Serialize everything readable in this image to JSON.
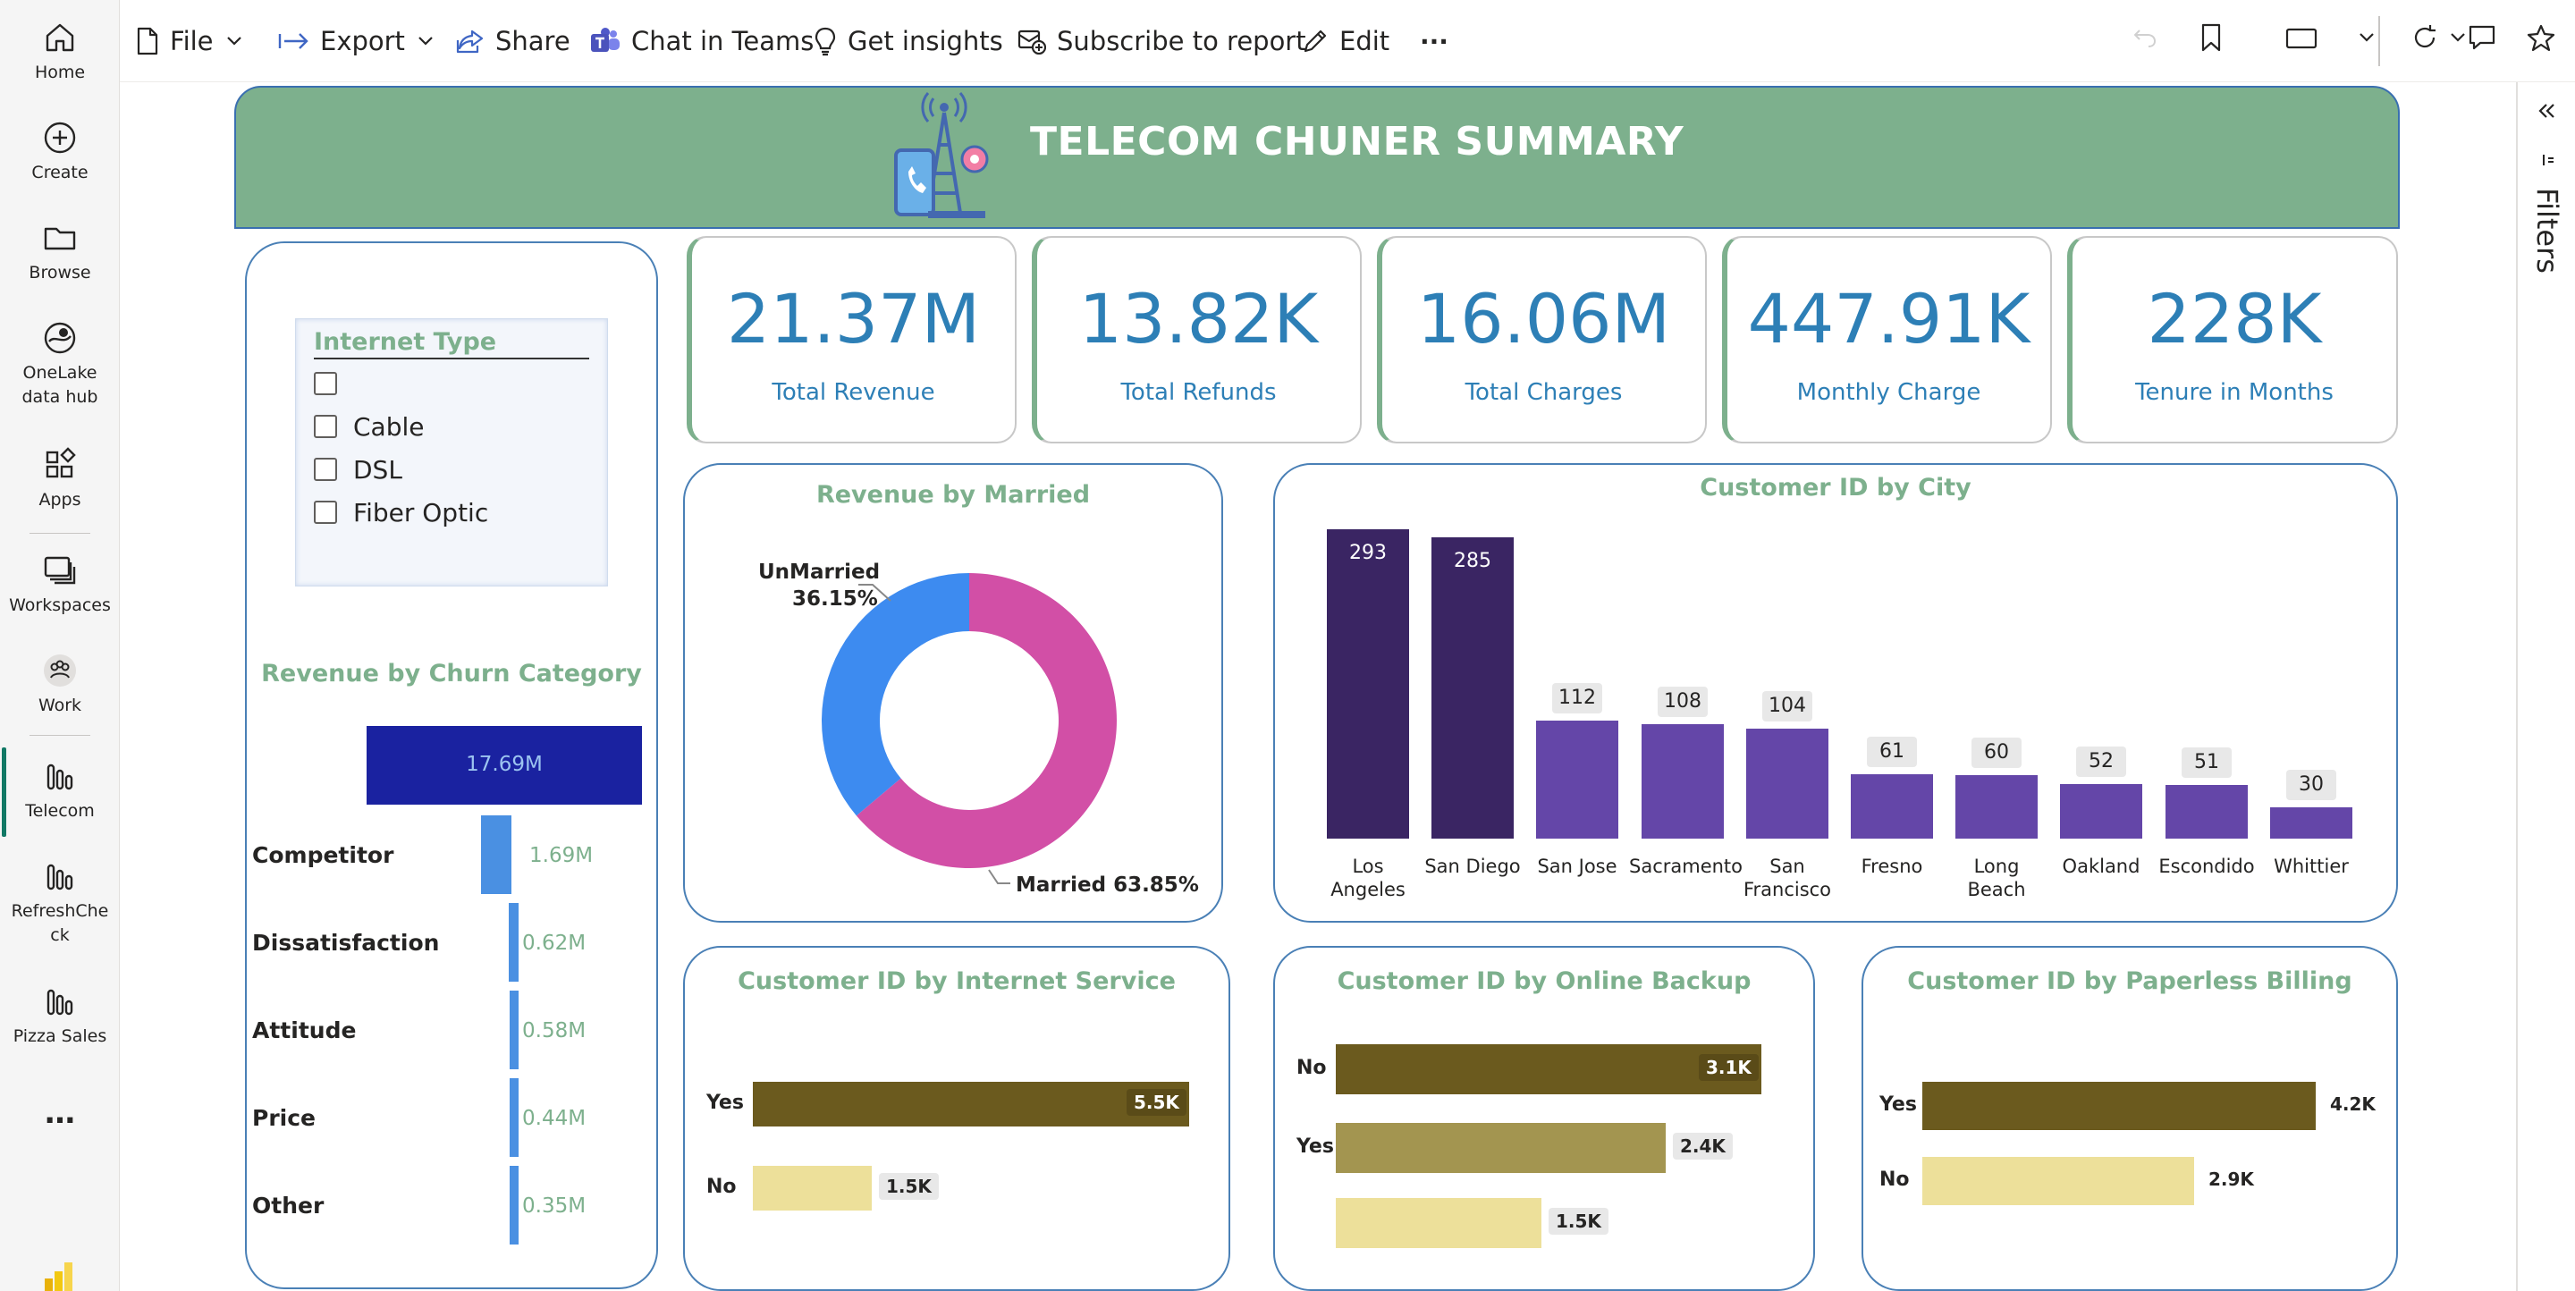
{
  "nav": {
    "items": [
      {
        "label": "Home",
        "icon": "home-icon"
      },
      {
        "label": "Create",
        "icon": "plus-circle-icon"
      },
      {
        "label": "Browse",
        "icon": "folder-icon"
      },
      {
        "label": "OneLake data hub",
        "icon": "onelake-icon"
      },
      {
        "label": "Apps",
        "icon": "apps-icon"
      },
      {
        "label": "Workspaces",
        "icon": "workspaces-icon"
      },
      {
        "label": "Work",
        "icon": "work-icon"
      },
      {
        "label": "Telecom",
        "icon": "report-icon"
      },
      {
        "label": "RefreshCheck",
        "icon": "report-icon"
      },
      {
        "label": "Pizza Sales",
        "icon": "report-icon"
      }
    ],
    "more": "…",
    "active": "Telecom"
  },
  "toolbar": {
    "file": "File",
    "export": "Export",
    "share": "Share",
    "chat": "Chat in Teams",
    "insights": "Get insights",
    "subscribe": "Subscribe to report",
    "edit": "Edit",
    "more": "···"
  },
  "filters": {
    "label": "Filters"
  },
  "report": {
    "title": "TELECOM CHUNER SUMMARY",
    "accent": "#7db08d",
    "kpi_color": "#2d7fb6",
    "kpis": [
      {
        "value": "21.37M",
        "label": "Total Revenue"
      },
      {
        "value": "13.82K",
        "label": "Total Refunds"
      },
      {
        "value": "16.06M",
        "label": "Total Charges"
      },
      {
        "value": "447.91K",
        "label": "Monthly Charge"
      },
      {
        "value": "228K",
        "label": "Tenure in Months"
      }
    ],
    "slicer": {
      "title": "Internet Type",
      "options": [
        "",
        "Cable",
        "DSL",
        "Fiber Optic"
      ]
    }
  },
  "chart_data": [
    {
      "type": "bar",
      "orientation": "horizontal",
      "title": "Revenue by Churn Category",
      "categories": [
        "",
        "Competitor",
        "Dissatisfaction",
        "Attitude",
        "Price",
        "Other"
      ],
      "values": [
        17.69,
        1.69,
        0.62,
        0.58,
        0.44,
        0.35
      ],
      "value_labels": [
        "17.69M",
        "1.69M",
        "0.62M",
        "0.58M",
        "0.44M",
        "0.35M"
      ],
      "unit": "M"
    },
    {
      "type": "pie",
      "donut": true,
      "title": "Revenue by Married",
      "labels": [
        "UnMarried",
        "Married"
      ],
      "values": [
        36.15,
        63.85
      ],
      "value_labels": [
        "36.15%",
        "63.85%"
      ],
      "colors": [
        "#3d8bf0",
        "#d24fa6"
      ]
    },
    {
      "type": "bar",
      "title": "Customer ID by City",
      "categories": [
        "Los Angeles",
        "San Diego",
        "San Jose",
        "Sacramento",
        "San Francisco",
        "Fresno",
        "Long Beach",
        "Oakland",
        "Escondido",
        "Whittier"
      ],
      "values": [
        293,
        285,
        112,
        108,
        104,
        61,
        60,
        52,
        51,
        30
      ],
      "colors": {
        "top": "#3a2563",
        "rest": "#6446a8"
      }
    },
    {
      "type": "bar",
      "orientation": "horizontal",
      "title": "Customer ID by Internet Service",
      "categories": [
        "Yes",
        "No"
      ],
      "values": [
        5.5,
        1.5
      ],
      "value_labels": [
        "5.5K",
        "1.5K"
      ],
      "colors": [
        "#6b5a1e",
        "#ede09a"
      ]
    },
    {
      "type": "bar",
      "orientation": "horizontal",
      "title": "Customer ID by Online Backup",
      "categories": [
        "No",
        "Yes",
        ""
      ],
      "values": [
        3.1,
        2.4,
        1.5
      ],
      "value_labels": [
        "3.1K",
        "2.4K",
        "1.5K"
      ],
      "colors": [
        "#6b5a1e",
        "#a39550",
        "#ede09a"
      ]
    },
    {
      "type": "bar",
      "orientation": "horizontal",
      "title": "Customer ID by Paperless Billing",
      "categories": [
        "Yes",
        "No"
      ],
      "values": [
        4.2,
        2.9
      ],
      "value_labels": [
        "4.2K",
        "2.9K"
      ],
      "colors": [
        "#6b5a1e",
        "#ede09a"
      ]
    }
  ]
}
